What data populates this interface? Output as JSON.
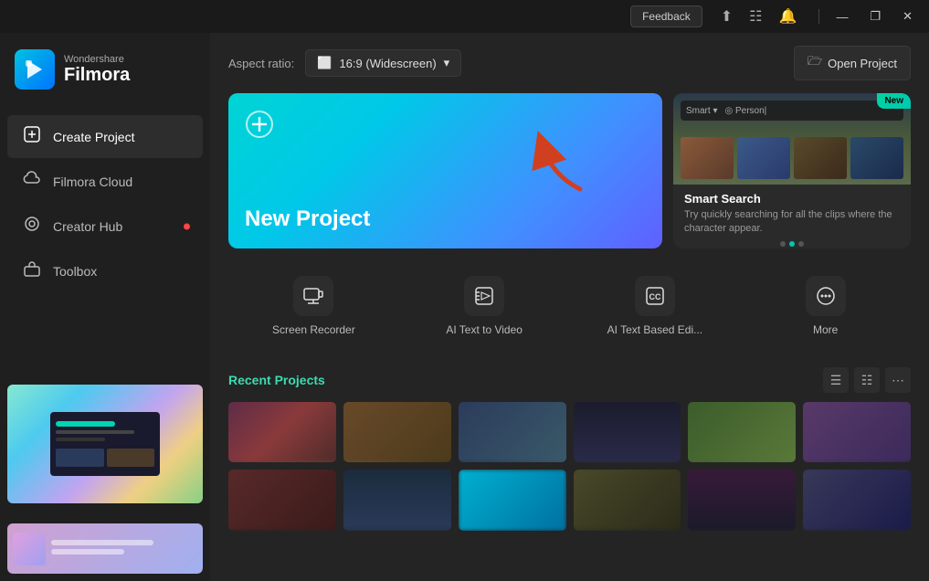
{
  "titlebar": {
    "feedback_label": "Feedback",
    "minimize_label": "—",
    "maximize_label": "❐",
    "close_label": "✕"
  },
  "sidebar": {
    "logo": {
      "brand": "Wondershare",
      "product": "Filmora"
    },
    "nav": [
      {
        "id": "create-project",
        "label": "Create Project",
        "icon": "⊞",
        "active": true,
        "dot": false
      },
      {
        "id": "filmora-cloud",
        "label": "Filmora Cloud",
        "icon": "☁",
        "active": false,
        "dot": false
      },
      {
        "id": "creator-hub",
        "label": "Creator Hub",
        "icon": "◎",
        "active": false,
        "dot": true
      },
      {
        "id": "toolbox",
        "label": "Toolbox",
        "icon": "⊡",
        "active": false,
        "dot": false
      }
    ]
  },
  "topbar": {
    "aspect_label": "Aspect ratio:",
    "aspect_value": "16:9 (Widescreen)",
    "open_project_label": "Open Project"
  },
  "new_project": {
    "title": "New Project"
  },
  "smart_search": {
    "badge": "New",
    "title": "Smart Search",
    "description": "Try quickly searching for all the clips where the character appear.",
    "dots": [
      {
        "active": false
      },
      {
        "active": true
      },
      {
        "active": false
      }
    ]
  },
  "quick_actions": [
    {
      "id": "screen-recorder",
      "label": "Screen Recorder",
      "icon": "⊞"
    },
    {
      "id": "ai-text-to-video",
      "label": "AI Text to Video",
      "icon": "⊟"
    },
    {
      "id": "ai-text-based-edit",
      "label": "AI Text Based Edi...",
      "icon": "CC"
    },
    {
      "id": "more",
      "label": "More",
      "icon": "⊕"
    }
  ],
  "recent_section": {
    "title": "Recent Projects"
  },
  "videos": [
    {
      "id": 1,
      "bg": "vt-1"
    },
    {
      "id": 2,
      "bg": "vt-2"
    },
    {
      "id": 3,
      "bg": "vt-3"
    },
    {
      "id": 4,
      "bg": "vt-4"
    },
    {
      "id": 5,
      "bg": "vt-5"
    },
    {
      "id": 6,
      "bg": "vt-6"
    },
    {
      "id": 7,
      "bg": "vt-7"
    },
    {
      "id": 8,
      "bg": "vt-8"
    },
    {
      "id": 9,
      "bg": "vt-9"
    },
    {
      "id": 10,
      "bg": "vt-10"
    },
    {
      "id": 11,
      "bg": "vt-11"
    },
    {
      "id": 12,
      "bg": "vt-12"
    }
  ],
  "colors": {
    "accent": "#00d4b0",
    "danger": "#ff4444",
    "sidebar_bg": "#1f1f1f",
    "main_bg": "#242424"
  }
}
